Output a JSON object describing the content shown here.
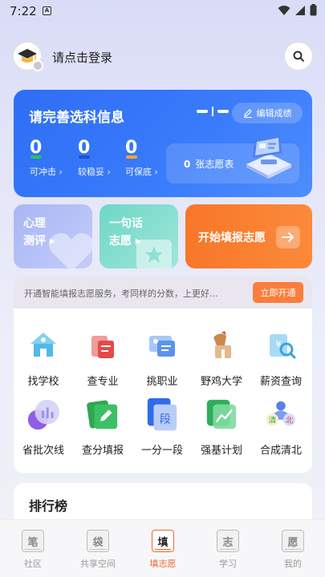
{
  "status_bar": {
    "time": "7:22",
    "notification": "A"
  },
  "header": {
    "login_text": "请点击登录"
  },
  "blue_card": {
    "title": "请完善选科信息",
    "edit_label": "编辑成绩",
    "stats": [
      {
        "value": "0",
        "label": "可冲击 ›",
        "color": "#2ec25b"
      },
      {
        "value": "0",
        "label": "较稳妥 ›",
        "color": "#1d52d6"
      },
      {
        "value": "0",
        "label": "可保底 ›",
        "color": "#f7a52b"
      }
    ],
    "wish_count": "0",
    "wish_label": "张志愿表"
  },
  "cards": {
    "a_line1": "心理",
    "a_line2": "测评 ▸",
    "b_line1": "一句话",
    "b_line2": "志愿 ▸",
    "c_label": "开始填报志愿"
  },
  "promo": {
    "text": "开通智能填报志愿服务，考同样的分数，上更好...",
    "button": "立即开通"
  },
  "grid": [
    {
      "label": "找学校",
      "icon": "school-icon"
    },
    {
      "label": "查专业",
      "icon": "major-icon"
    },
    {
      "label": "挑职业",
      "icon": "career-icon"
    },
    {
      "label": "野鸡大学",
      "icon": "fake-university-icon"
    },
    {
      "label": "薪资查询",
      "icon": "salary-icon"
    },
    {
      "label": "省批次线",
      "icon": "batch-line-icon"
    },
    {
      "label": "查分填报",
      "icon": "score-icon"
    },
    {
      "label": "一分一段",
      "icon": "segment-icon"
    },
    {
      "label": "强基计划",
      "icon": "strong-base-icon"
    },
    {
      "label": "合成清北",
      "icon": "qingbei-icon"
    }
  ],
  "ranking": {
    "title": "排行榜"
  },
  "nav": [
    {
      "glyph": "笔",
      "label": "社区"
    },
    {
      "glyph": "袋",
      "label": "共享空间"
    },
    {
      "glyph": "填",
      "label": "填志愿",
      "active": true
    },
    {
      "glyph": "志",
      "label": "学习"
    },
    {
      "glyph": "愿",
      "label": "我的"
    }
  ],
  "colors": {
    "primary_blue": "#3171f7",
    "accent_orange": "#f97a30",
    "nav_active": "#f0682c"
  }
}
